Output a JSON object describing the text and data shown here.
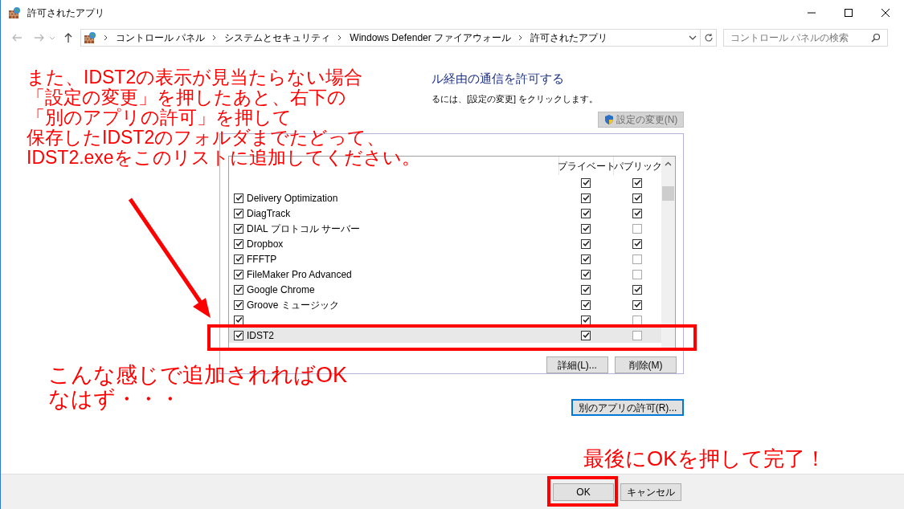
{
  "window": {
    "title": "許可されたアプリ"
  },
  "address_bar": {
    "crumbs": [
      "コントロール パネル",
      "システムとセキュリティ",
      "Windows Defender ファイアウォール",
      "許可されたアプリ"
    ]
  },
  "search": {
    "placeholder": "コントロール パネルの検索"
  },
  "heading": "ル経由の通信を許可する",
  "subtext": "るには、[設定の変更] をクリックします。",
  "change_settings_button": {
    "label": "設定の変更(N)",
    "disabled": true
  },
  "app_list": {
    "columns": [
      "プライベート",
      "パブリック"
    ],
    "rows": [
      {
        "private": true,
        "public": true,
        "selected": false
      },
      {
        "name": "Delivery Optimization",
        "enabled": true,
        "private": true,
        "public": true,
        "selected": false
      },
      {
        "name": "DiagTrack",
        "enabled": true,
        "private": true,
        "public": true,
        "selected": false
      },
      {
        "name": "DIAL プロトコル サーバー",
        "enabled": true,
        "private": true,
        "public": false,
        "selected": false
      },
      {
        "name": "Dropbox",
        "enabled": true,
        "private": true,
        "public": true,
        "selected": false
      },
      {
        "name": "FFFTP",
        "enabled": true,
        "private": true,
        "public": false,
        "selected": false
      },
      {
        "name": "FileMaker Pro Advanced",
        "enabled": true,
        "private": true,
        "public": false,
        "selected": false
      },
      {
        "name": "Google Chrome",
        "enabled": true,
        "private": true,
        "public": true,
        "selected": false
      },
      {
        "name": "Groove ミュージック",
        "enabled": true,
        "private": true,
        "public": true,
        "selected": false
      },
      {
        "enabled": true,
        "private": true,
        "public": false,
        "selected": false
      },
      {
        "name": "IDST2",
        "enabled": true,
        "private": true,
        "public": false,
        "selected": true
      }
    ]
  },
  "list_buttons": [
    "詳細(L)...",
    "削除(M)"
  ],
  "allow_other_app_button": "別のアプリの許可(R)...",
  "footer_buttons": [
    "OK",
    "キャンセル"
  ],
  "annotations": {
    "instruction_lines": [
      "また、IDST2の表示が見当たらない場合",
      "「設定の変更」を押したあと、右下の",
      "「別のアプリの許可」を押して",
      "保存したIDST2のフォルダまでたどって、",
      "IDST2.exeをこのリストに追加してください。"
    ],
    "result_lines": [
      "こんな感じで追加されればOK",
      "なはず・・・"
    ],
    "final_note": "最後にOKを押して完了！"
  }
}
